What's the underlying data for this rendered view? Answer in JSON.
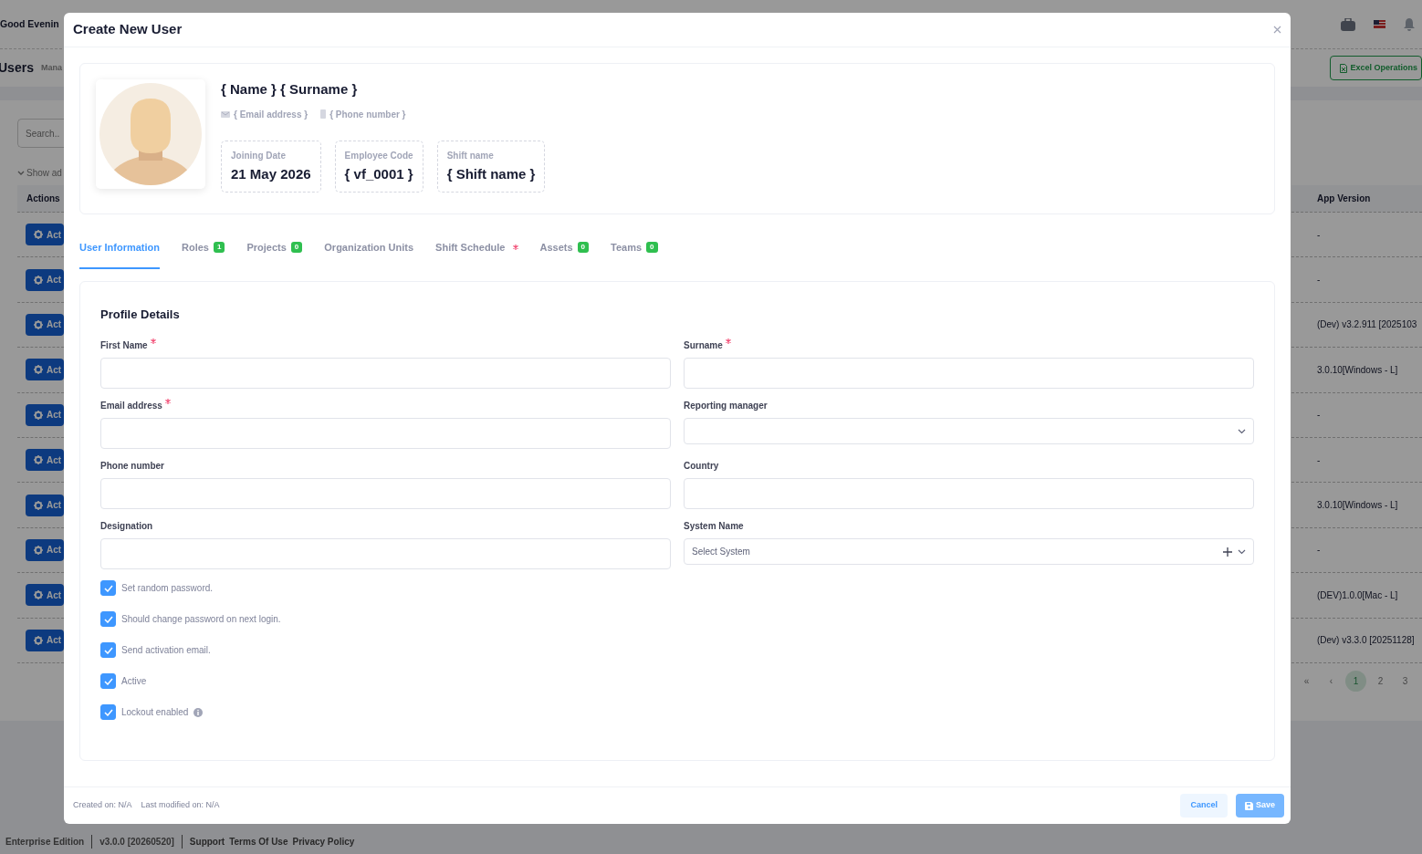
{
  "page": {
    "greeting": "Good Evenin",
    "title": "Users",
    "subtitle": "Mana",
    "excel_button": "Excel Operations",
    "search": {
      "placeholder": "Search.."
    },
    "show_advanced": "Show ad",
    "table": {
      "columns": [
        "Actions",
        "App Version"
      ],
      "rows": [
        {
          "action": "Act",
          "app_version": "-"
        },
        {
          "action": "Act",
          "app_version": "-"
        },
        {
          "action": "Act",
          "app_version": "(Dev) v3.2.911 [2025103"
        },
        {
          "action": "Act",
          "app_version": "3.0.10[Windows - L]"
        },
        {
          "action": "Act",
          "app_version": "-"
        },
        {
          "action": "Act",
          "app_version": "-"
        },
        {
          "action": "Act",
          "app_version": "3.0.10[Windows - L]"
        },
        {
          "action": "Act",
          "app_version": "-"
        },
        {
          "action": "Act",
          "app_version": "(DEV)1.0.0[Mac - L]"
        },
        {
          "action": "Act",
          "app_version": "(Dev) v3.3.0 [20251128]"
        }
      ]
    },
    "pagination": [
      {
        "label": "«",
        "selected": false
      },
      {
        "label": "‹",
        "selected": false
      },
      {
        "label": "1",
        "selected": true
      },
      {
        "label": "2",
        "selected": false
      },
      {
        "label": "3",
        "selected": false
      }
    ],
    "footer": {
      "edition": "Enterprise Edition",
      "version": "v3.0.0 [20260520]",
      "links": [
        "Support",
        "Terms Of Use",
        "Privacy Policy"
      ]
    }
  },
  "modal": {
    "title": "Create New User",
    "profile": {
      "name": "{ Name } { Surname }",
      "email": "{ Email address }",
      "phone": "{ Phone number }",
      "stats": [
        {
          "label": "Joining Date",
          "value": "21 May 2026"
        },
        {
          "label": "Employee Code",
          "value": "{ vf_0001 }"
        },
        {
          "label": "Shift name",
          "value": "{ Shift name }"
        }
      ]
    },
    "tabs": [
      {
        "label": "User Information",
        "selected": true,
        "required": false
      },
      {
        "label": "Roles",
        "count": "1",
        "selected": false,
        "required": false
      },
      {
        "label": "Projects",
        "count": "0",
        "selected": false,
        "required": false
      },
      {
        "label": "Organization Units",
        "selected": false,
        "required": false
      },
      {
        "label": "Shift Schedule",
        "selected": false,
        "required": true
      },
      {
        "label": "Assets",
        "count": "0",
        "selected": false,
        "required": false
      },
      {
        "label": "Teams",
        "count": "0",
        "selected": false,
        "required": false
      }
    ],
    "section_title": "Profile Details",
    "fields": [
      {
        "label": "First Name",
        "required": true,
        "kind": "text"
      },
      {
        "label": "Surname",
        "required": true,
        "kind": "text"
      },
      {
        "label": "Email address",
        "required": true,
        "kind": "text"
      },
      {
        "label": "Reporting manager",
        "required": false,
        "kind": "select"
      },
      {
        "label": "Phone number",
        "required": false,
        "kind": "text"
      },
      {
        "label": "Country",
        "required": false,
        "kind": "text"
      },
      {
        "label": "Designation",
        "required": false,
        "kind": "text"
      },
      {
        "label": "System Name",
        "required": false,
        "kind": "multiselect",
        "placeholder": "Select System"
      }
    ],
    "checkboxes": [
      {
        "label": "Set random password.",
        "checked": true,
        "info": false
      },
      {
        "label": "Should change password on next login.",
        "checked": true,
        "info": false
      },
      {
        "label": "Send activation email.",
        "checked": true,
        "info": false
      },
      {
        "label": "Active",
        "checked": true,
        "info": false
      },
      {
        "label": "Lockout enabled",
        "checked": true,
        "info": true
      }
    ],
    "footer": {
      "created": "Created on: N/A",
      "modified": "Last modified on: N/A"
    },
    "buttons": [
      {
        "label": "Cancel",
        "kind": "cancel",
        "disabled": false
      },
      {
        "label": "Save",
        "kind": "save",
        "disabled": true
      }
    ]
  }
}
